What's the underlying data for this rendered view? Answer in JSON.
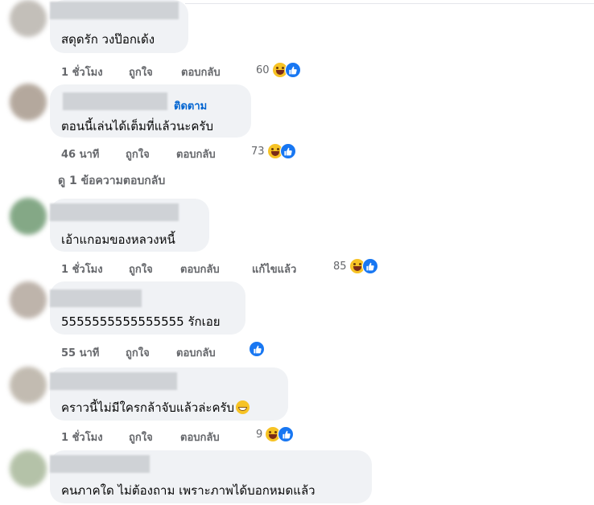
{
  "comments": [
    {
      "text": "สดุดรัก วงป๊อกเด้ง",
      "time": "1 ชั่วโมง",
      "like": "ถูกใจ",
      "reply": "ตอบกลับ",
      "count": "60"
    },
    {
      "follow": "ติดตาม",
      "text": "ตอนนี้เล่นได้เต็มที่แล้วนะครับ",
      "time": "46 นาที",
      "like": "ถูกใจ",
      "reply": "ตอบกลับ",
      "count": "73"
    },
    {
      "text": "เอ้าแกอมของหลวงหนี้",
      "time": "1 ชั่วโมง",
      "like": "ถูกใจ",
      "reply": "ตอบกลับ",
      "edited": "แก้ไขแล้ว",
      "count": "85"
    },
    {
      "text": "5555555555555555 รักเอย",
      "time": "55 นาที",
      "like": "ถูกใจ",
      "reply": "ตอบกลับ"
    },
    {
      "text": "คราวนี้ไม่มีใครกล้าจับแล้วล่ะครับ",
      "time": "1 ชั่วโมง",
      "like": "ถูกใจ",
      "reply": "ตอบกลับ",
      "count": "9"
    },
    {
      "text": "คนภาคใด ไม่ต้องถาม เพราะภาพได้บอกหมดแล้ว"
    }
  ],
  "view_replies": "ดู 1 ข้อความตอบกลับ",
  "icons": {
    "reaction_haha": "haha-emoji-icon",
    "reaction_like": "like-thumb-icon",
    "inline": "grin-emoji-icon"
  },
  "colors": {
    "bubble": "#f0f2f5",
    "link": "#0064d1",
    "meta": "#65676b",
    "like": "#1877f2"
  }
}
